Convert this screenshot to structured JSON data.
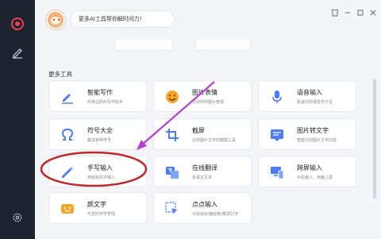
{
  "header": {
    "tip": "更多AI工具帮你解时间力！"
  },
  "section": {
    "title": "更多工具"
  },
  "tools": [
    {
      "title": "智能写作",
      "desc": "你身边的AI写作助手",
      "icon": "pen-write-icon"
    },
    {
      "title": "图片表情",
      "desc": "识别你的图片表情",
      "icon": "emoji-icon"
    },
    {
      "title": "语音输入",
      "desc": "极速识别语音多方言",
      "icon": "microphone-icon"
    },
    {
      "title": "符号大全",
      "desc": "集成各种符号",
      "icon": "omega-icon"
    },
    {
      "title": "截屏",
      "desc": "识别图片文字的截图工具",
      "icon": "screenshot-icon"
    },
    {
      "title": "图片转文字",
      "desc": "智能识别图片文字内容",
      "icon": "image-text-icon"
    },
    {
      "title": "手写输入",
      "desc": "用鼠标写字输入",
      "icon": "handwrite-icon"
    },
    {
      "title": "在线翻译",
      "desc": "多语言互译",
      "icon": "translate-icon"
    },
    {
      "title": "跨屏输入",
      "desc": "手机输入，电脑上屏",
      "icon": "cross-screen-icon"
    },
    {
      "title": "颜文字",
      "desc": "可爱的字符表情",
      "icon": "kaomoji-icon"
    },
    {
      "title": "点点输入",
      "desc": "识别鼠标/触控板/截屏打字",
      "icon": "click-input-icon"
    }
  ],
  "colors": {
    "accent": "#4a7cf6",
    "annotation": "#c0282c",
    "arrow": "#b43dd8",
    "sidebar": "#1e2330"
  }
}
